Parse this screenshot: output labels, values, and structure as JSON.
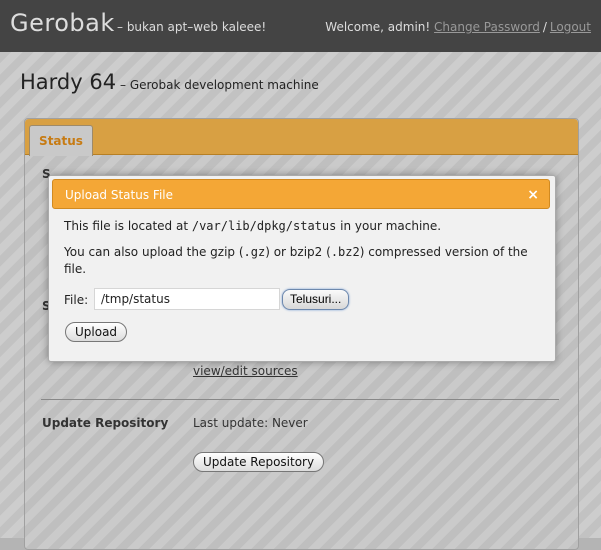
{
  "app": {
    "brand": "Gerobak",
    "tagline": "– bukan apt–web kaleee!"
  },
  "user": {
    "welcome": "Welcome, admin!",
    "change_password": "Change Password",
    "separator": "/",
    "logout": "Logout"
  },
  "page": {
    "title": "Hardy 64",
    "subtitle": "– Gerobak development machine"
  },
  "tabs": [
    {
      "label": "Status",
      "active": true
    }
  ],
  "sections": {
    "partial_label_1": "S",
    "partial_label_2": "S",
    "sources_link": "view/edit sources",
    "update_repository": {
      "label": "Update Repository",
      "last_update": "Last update: Never",
      "button": "Update Repository"
    }
  },
  "modal": {
    "title": "Upload Status File",
    "close_glyph": "×",
    "line1_pre": "This file is located at ",
    "line1_path": "/var/lib/dpkg/status",
    "line1_post": " in your machine.",
    "line2_pre": "You can also upload the gzip (",
    "line2_gz": ".gz",
    "line2_mid": ") or bzip2 (",
    "line2_bz2": ".bz2",
    "line2_post": ") compressed version of the file.",
    "file_label": "File:",
    "file_value": "/tmp/status",
    "browse_button": "Telusuri...",
    "upload_button": "Upload"
  },
  "colors": {
    "accent": "#f4a736",
    "panel_header": "#d8a043",
    "topbar": "#444444"
  }
}
